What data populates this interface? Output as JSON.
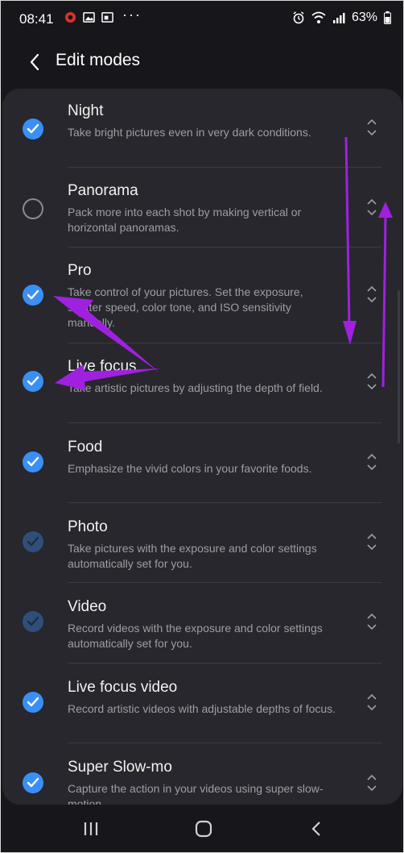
{
  "status_bar": {
    "time": "08:41",
    "more": "···",
    "battery": "63%"
  },
  "header": {
    "title": "Edit modes"
  },
  "modes": [
    {
      "title": "Night",
      "description": "Take bright pictures even in very dark conditions.",
      "state": "checked"
    },
    {
      "title": "Panorama",
      "description": "Pack more into each shot by making vertical or horizontal panoramas.",
      "state": "unchecked"
    },
    {
      "title": "Pro",
      "description": "Take control of your pictures. Set the exposure, shutter speed, color tone, and ISO sensitivity manually.",
      "state": "checked"
    },
    {
      "title": "Live focus",
      "description": "Take artistic pictures by adjusting the depth of field.",
      "state": "checked"
    },
    {
      "title": "Food",
      "description": "Emphasize the vivid colors in your favorite foods.",
      "state": "checked"
    },
    {
      "title": "Photo",
      "description": "Take pictures with the exposure and color settings automatically set for you.",
      "state": "checked-disabled"
    },
    {
      "title": "Video",
      "description": "Record videos with the exposure and color settings automatically set for you.",
      "state": "checked-disabled"
    },
    {
      "title": "Live focus video",
      "description": "Record artistic videos with adjustable depths of focus.",
      "state": "checked"
    },
    {
      "title": "Super Slow-mo",
      "description": "Capture the action in your videos using super slow-motion.",
      "state": "checked"
    }
  ],
  "colors": {
    "accent": "#3a8ff5",
    "annotation_arrow": "#a020e0"
  }
}
